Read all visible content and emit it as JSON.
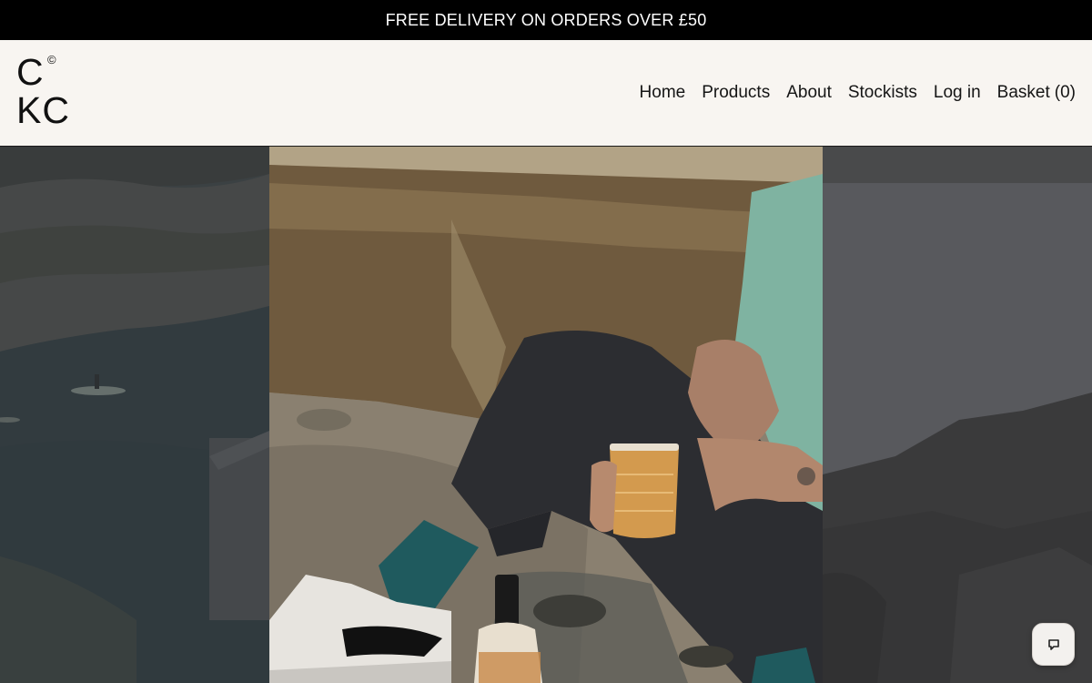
{
  "announcement": {
    "text": "FREE DELIVERY ON ORDERS OVER £50"
  },
  "logo": {
    "line1": "C",
    "mark": "©",
    "line2": "KC"
  },
  "nav": {
    "home": "Home",
    "products": "Products",
    "about": "About",
    "stockists": "Stockists",
    "login": "Log in",
    "basket_label": "Basket",
    "basket_count": "(0)"
  },
  "hero": {
    "left_image": "coastal-kayak-photo",
    "center_image": "person-drinking-on-beach-photo",
    "right_image": "rocky-shore-photo"
  },
  "chat": {
    "icon": "chat-bubble-icon"
  },
  "colors": {
    "announcement_bg": "#000000",
    "header_bg": "#f8f5f1",
    "text": "#151515",
    "sock_teal": "#1f5a5e",
    "shirt_mint": "#7fb3a1"
  }
}
